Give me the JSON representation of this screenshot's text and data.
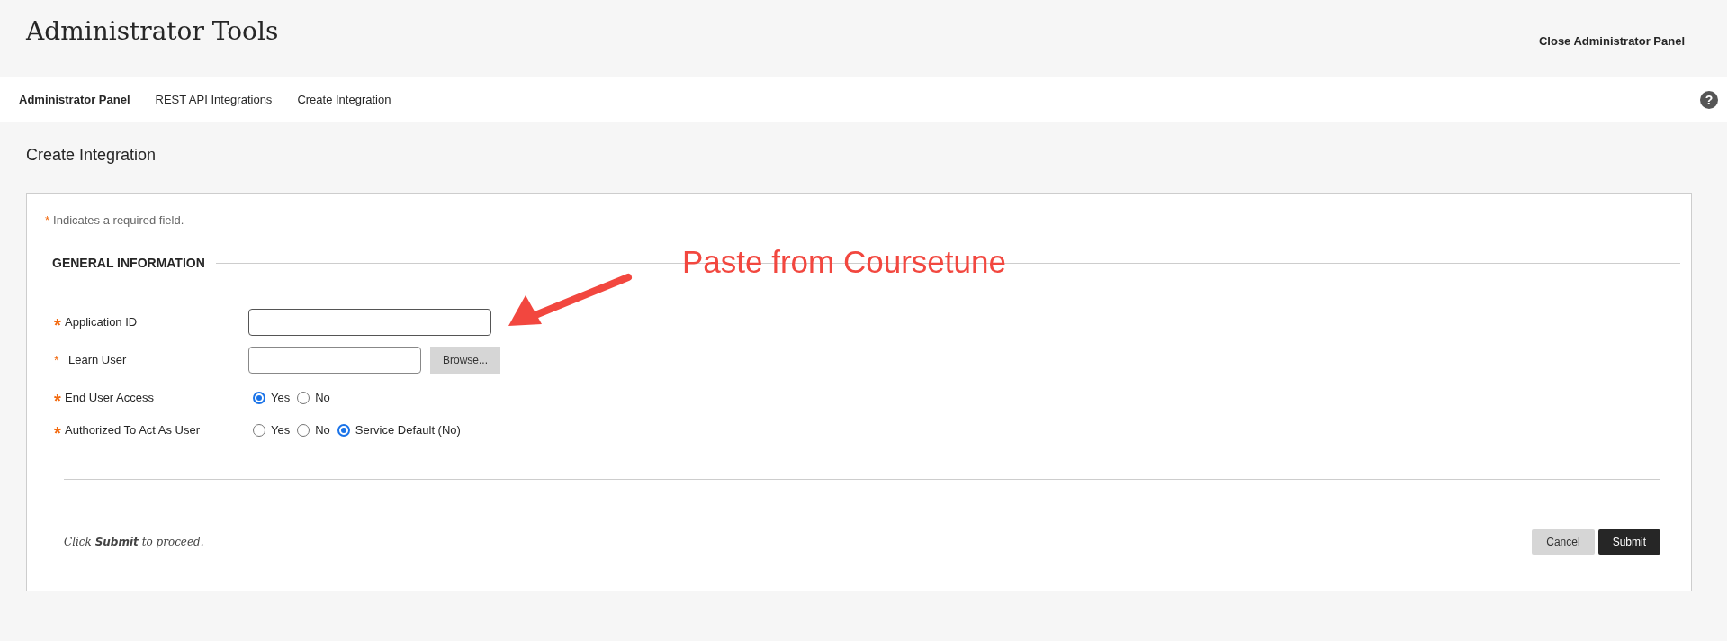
{
  "header": {
    "title": "Administrator Tools",
    "close_link": "Close Administrator Panel"
  },
  "breadcrumbs": [
    {
      "label": "Administrator Panel",
      "kind": "root"
    },
    {
      "label": "REST API Integrations",
      "kind": "link"
    },
    {
      "label": "Create Integration",
      "kind": "link"
    }
  ],
  "help": "?",
  "page_title": "Create Integration",
  "required_note": {
    "mark": "*",
    "text": "Indicates a required field."
  },
  "section": {
    "title": "GENERAL INFORMATION"
  },
  "fields": [
    {
      "kind": "text",
      "mark": "*",
      "label": "Application ID",
      "focused": true
    },
    {
      "kind": "browse",
      "mark": "*",
      "label": "Learn User",
      "focused": false,
      "button": "Browse..."
    },
    {
      "kind": "radio",
      "mark": "*",
      "label": "End User Access",
      "options": [
        {
          "label": "Yes",
          "selected": true
        },
        {
          "label": "No",
          "selected": false
        }
      ]
    },
    {
      "kind": "radio",
      "mark": "*",
      "label": "Authorized To Act As User",
      "options": [
        {
          "label": "Yes",
          "selected": false
        },
        {
          "label": "No",
          "selected": false
        },
        {
          "label": "Service Default (No)",
          "selected": true
        }
      ]
    }
  ],
  "footer": {
    "note": "Click **Submit** to proceed.",
    "buttons": [
      {
        "label": "Cancel",
        "kind": "secondary"
      },
      {
        "label": "Submit",
        "kind": "primary"
      }
    ]
  },
  "annotation": {
    "text": "Paste from Coursetune"
  }
}
